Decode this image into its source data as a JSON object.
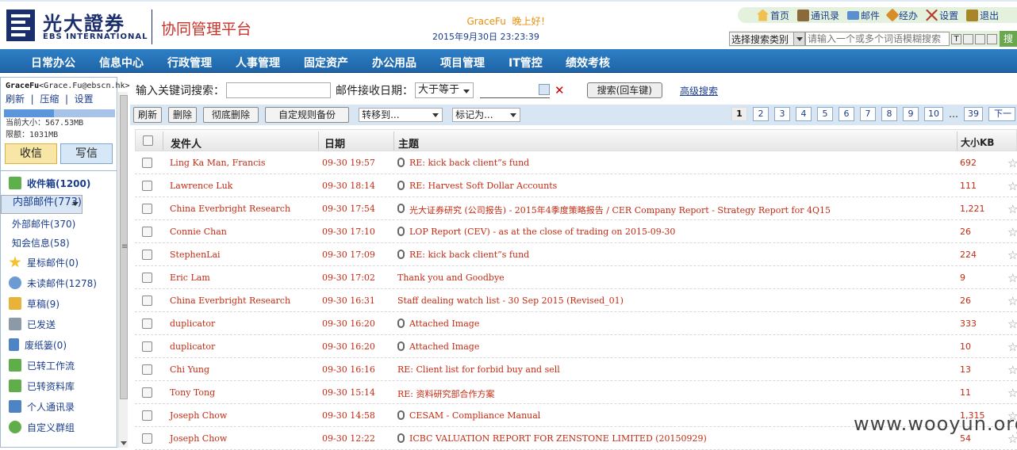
{
  "header": {
    "logo_cn": "光大證券",
    "logo_en": "EBS INTERNATIONAL",
    "platform": "协同管理平台",
    "greeting_name": "GraceFu",
    "greeting_text": "晚上好！",
    "datetime": "2015年9月30日  23:23:39",
    "links": [
      {
        "label": "首页",
        "icon": "home-icon"
      },
      {
        "label": "通讯录",
        "icon": "contacts-icon"
      },
      {
        "label": "邮件",
        "icon": "mail-icon"
      },
      {
        "label": "经办",
        "icon": "task-icon"
      },
      {
        "label": "设置",
        "icon": "tools-icon"
      },
      {
        "label": "退出",
        "icon": "exit-icon"
      }
    ],
    "search_category": "选择搜索类别",
    "search_placeholder": "请输入一个或多个词语模糊搜索",
    "search_button": "搜"
  },
  "nav": [
    "日常办公",
    "信息中心",
    "行政管理",
    "人事管理",
    "固定资产",
    "办公用品",
    "项目管理",
    "IT管控",
    "绩效考核"
  ],
  "sidebar": {
    "user": "GraceFu",
    "email": "<Grace.Fu@ebscn.hk>",
    "refresh": "刷新",
    "compress": "压缩",
    "settings": "设置",
    "quota_used_fraction": 0.45,
    "size_label": "当前大小：567.53MB",
    "limit_label": "限额：1031MB",
    "receive": "收信",
    "compose": "写信",
    "folders": [
      {
        "label": "收件箱(1200)",
        "icon": "inbox-icon"
      },
      {
        "label": "内部邮件(773)",
        "icon": ""
      },
      {
        "label": "外部邮件(370)",
        "icon": ""
      },
      {
        "label": "知会信息(58)",
        "icon": ""
      },
      {
        "label": "星标邮件(0)",
        "icon": "star-icon"
      },
      {
        "label": "未读邮件(1278)",
        "icon": "unread-icon"
      },
      {
        "label": "草稿(9)",
        "icon": "draft-icon"
      },
      {
        "label": "已发送",
        "icon": "sent-icon"
      },
      {
        "label": "废纸篓(0)",
        "icon": "trash-icon"
      },
      {
        "label": "已转工作流",
        "icon": "workflow-icon"
      },
      {
        "label": "已转资料库",
        "icon": "library-icon"
      },
      {
        "label": "个人通讯录",
        "icon": "addressbook-icon"
      },
      {
        "label": "自定义群组",
        "icon": "group-icon"
      }
    ]
  },
  "search": {
    "keyword_label": "输入关键词搜索：",
    "date_label": "邮件接收日期：",
    "date_op": "大于等于",
    "search_button": "搜索(回车键)",
    "advanced": "高级搜索"
  },
  "toolbar": {
    "refresh": "刷新",
    "delete": "删除",
    "purge": "彻底删除",
    "backup": "自定规则备份",
    "move_to": "转移到...",
    "mark_as": "标记为...",
    "pages": [
      "1",
      "2",
      "3",
      "4",
      "5",
      "6",
      "7",
      "8",
      "9",
      "10"
    ],
    "ellipsis": "…",
    "last_page": "39",
    "next": "下一"
  },
  "columns": {
    "sender": "发件人",
    "date": "日期",
    "subject": "主题",
    "size": "大小KB"
  },
  "emails": [
    {
      "sender": "Ling Ka Man, Francis",
      "date": "09-30 19:57",
      "attach": true,
      "subject": "RE: kick back client”s fund",
      "size": "692"
    },
    {
      "sender": "Lawrence Luk",
      "date": "09-30 18:14",
      "attach": true,
      "subject": "RE: Harvest Soft Dollar Accounts",
      "size": "111"
    },
    {
      "sender": "China Everbright Research",
      "date": "09-30 17:54",
      "attach": true,
      "subject": "光大证券研究 (公司报告) - 2015年4季度策略报告 / CER Company Report - Strategy Report for 4Q15",
      "size": "1,221"
    },
    {
      "sender": "Connie Chan",
      "date": "09-30 17:10",
      "attach": true,
      "subject": "LOP Report (CEV) - as at the close of trading on 2015-09-30",
      "size": "26"
    },
    {
      "sender": "StephenLai",
      "date": "09-30 17:09",
      "attach": true,
      "subject": "RE: kick back client”s fund",
      "size": "224"
    },
    {
      "sender": "Eric Lam",
      "date": "09-30 17:02",
      "attach": false,
      "subject": "Thank you and Goodbye",
      "size": "9"
    },
    {
      "sender": "China Everbright Research",
      "date": "09-30 16:31",
      "attach": false,
      "subject": "Staff dealing watch list - 30 Sep 2015 (Revised_01)",
      "size": "26"
    },
    {
      "sender": "duplicator",
      "date": "09-30 16:20",
      "attach": true,
      "subject": "Attached Image",
      "size": "333"
    },
    {
      "sender": "duplicator",
      "date": "09-30 16:20",
      "attach": true,
      "subject": "Attached Image",
      "size": "10"
    },
    {
      "sender": "Chi Yung",
      "date": "09-30 16:16",
      "attach": false,
      "subject": "RE: Client list for forbid buy and sell",
      "size": "13"
    },
    {
      "sender": "Tony Tong",
      "date": "09-30 15:14",
      "attach": false,
      "subject": "RE: 资料研究部合作方案",
      "size": "11"
    },
    {
      "sender": "Joseph Chow",
      "date": "09-30 14:58",
      "attach": true,
      "subject": "CESAM - Compliance Manual",
      "size": "1,315"
    },
    {
      "sender": "Joseph Chow",
      "date": "09-30 12:22",
      "attach": true,
      "subject": "ICBC VALUATION REPORT FOR ZENSTONE LIMITED (20150929)",
      "size": "54"
    }
  ],
  "watermark": "www.wooyun.org",
  "colors": {
    "nav": "#1e64a8",
    "link": "#1a3d8c",
    "email_text": "#c52a12",
    "platform": "#c9322a",
    "greeting": "#e8900a"
  }
}
